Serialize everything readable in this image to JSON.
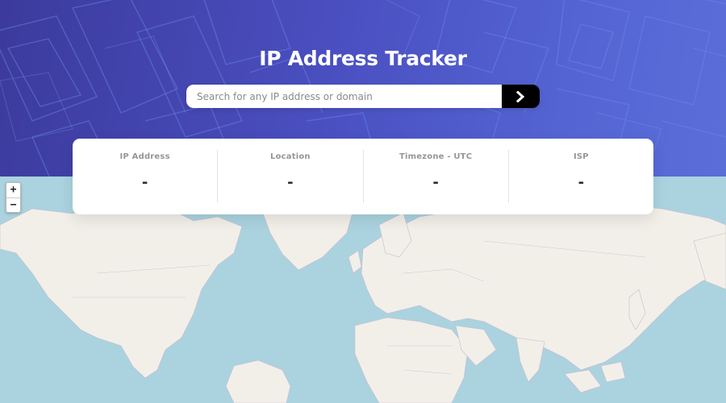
{
  "header": {
    "title": "IP Address Tracker",
    "background_colors": [
      "#3c3a9c",
      "#5a6ed8"
    ]
  },
  "search": {
    "placeholder": "Search for any IP address or domain",
    "value": "",
    "submit_icon": "chevron-right-icon"
  },
  "info": {
    "items": [
      {
        "label": "IP Address",
        "value": "-"
      },
      {
        "label": "Location",
        "value": "-"
      },
      {
        "label": "Timezone - UTC",
        "value": "-"
      },
      {
        "label": "ISP",
        "value": "-"
      }
    ]
  },
  "map": {
    "zoom_in_label": "+",
    "zoom_out_label": "−",
    "water_color": "#aad3df",
    "land_color": "#f2efe9"
  }
}
